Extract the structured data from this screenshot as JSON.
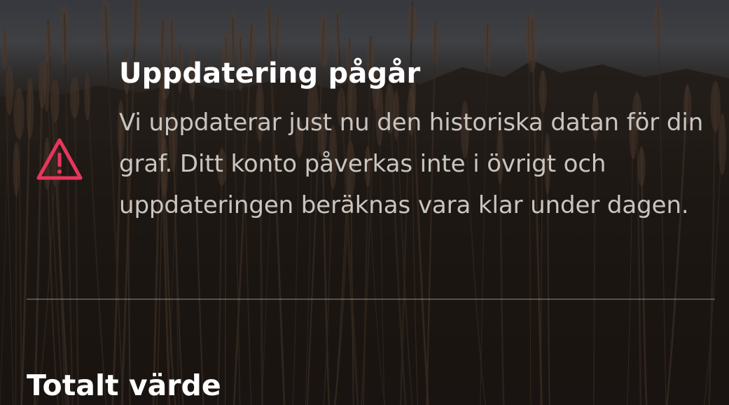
{
  "notice": {
    "icon": "warning-triangle-icon",
    "icon_color": "#e8365d",
    "title": "Uppdatering pågår",
    "body": "Vi uppdaterar just nu den historiska datan för din graf. Ditt konto påverkas inte i övrigt och uppdateringen beräknas vara klar under dagen."
  },
  "section": {
    "title": "Totalt värde"
  }
}
